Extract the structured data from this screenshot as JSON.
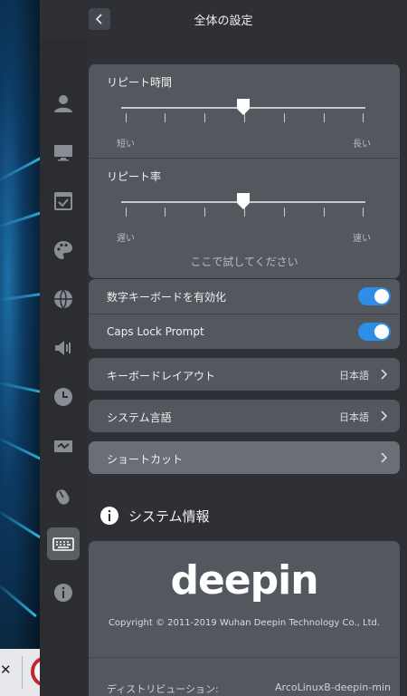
{
  "header": {
    "title": "全体の設定",
    "back_icon": "chevron-left-icon"
  },
  "sidebar": {
    "icons": [
      {
        "name": "account-icon"
      },
      {
        "name": "display-icon"
      },
      {
        "name": "default-apps-icon"
      },
      {
        "name": "personalization-icon"
      },
      {
        "name": "network-icon"
      },
      {
        "name": "sound-icon"
      },
      {
        "name": "datetime-icon"
      },
      {
        "name": "power-icon"
      },
      {
        "name": "mouse-icon"
      },
      {
        "name": "keyboard-icon",
        "active": true
      },
      {
        "name": "system-info-icon"
      }
    ]
  },
  "keyboard": {
    "repeat_delay": {
      "title": "リピート時間",
      "min_label": "短い",
      "max_label": "長い",
      "value": 0.5
    },
    "repeat_rate": {
      "title": "リピート率",
      "min_label": "遅い",
      "max_label": "速い",
      "value": 0.5
    },
    "test_hint": "ここで試してください",
    "numlock": {
      "label": "数字キーボードを有効化",
      "enabled": true
    },
    "capslock": {
      "label": "Caps Lock Prompt",
      "enabled": true
    },
    "layout": {
      "label": "キーボードレイアウト",
      "value": "日本語"
    },
    "language": {
      "label": "システム言語",
      "value": "日本語"
    },
    "shortcuts": {
      "label": "ショートカット"
    }
  },
  "system_info": {
    "heading": "システム情報",
    "logo": "deepin",
    "copyright": "Copyright © 2011-2019 Wuhan Deepin Technology Co., Ltd.",
    "distribution_label": "ディストリビューション:",
    "distribution_value": "ArcoLinuxB-deepin-min"
  },
  "colors": {
    "accent": "#2d8ee8",
    "card": "#53575e",
    "panel": "#2e3035"
  }
}
